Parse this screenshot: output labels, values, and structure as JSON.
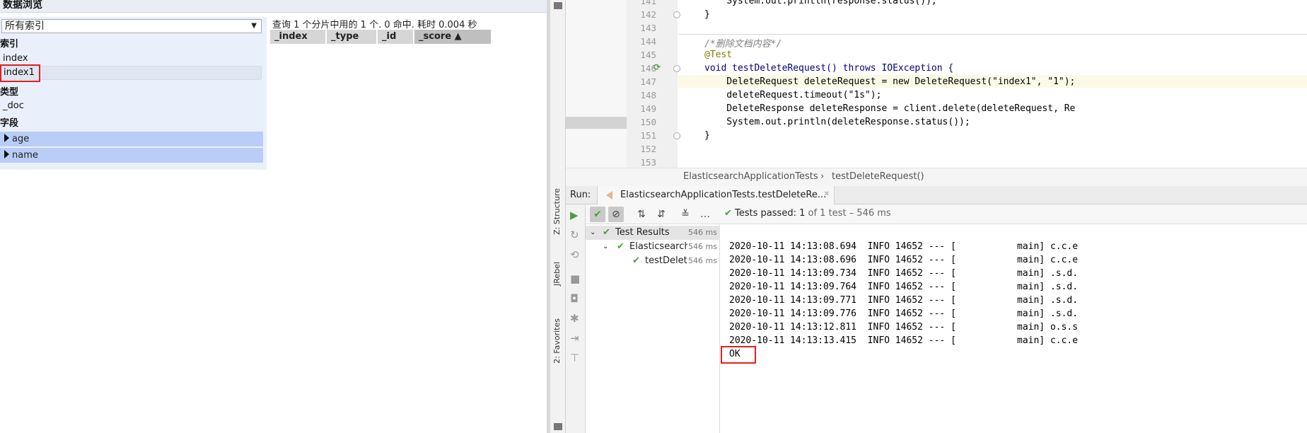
{
  "es": {
    "title": "数据浏览",
    "index_select": "所有索引",
    "sections": {
      "indices": "索引",
      "types": "类型",
      "fields": "字段"
    },
    "indices": [
      "index",
      "index1"
    ],
    "types": [
      "_doc"
    ],
    "fields": [
      "age",
      "name"
    ],
    "query_info": "查询 1 个分片中用的 1 个. 0 命中. 耗时 0.004 秒",
    "columns": [
      "_index",
      "_type",
      "_id",
      "_score ▲"
    ]
  },
  "editor": {
    "lines": [
      {
        "n": "141",
        "text": "    System.out.println(response.status());"
      },
      {
        "n": "142",
        "text": "}"
      },
      {
        "n": "143",
        "text": ""
      },
      {
        "n": "144",
        "text": "/*删除文档内容*/"
      },
      {
        "n": "145",
        "text": "@Test"
      },
      {
        "n": "146",
        "text": "void testDeleteRequest() throws IOException {"
      },
      {
        "n": "147",
        "text": "    DeleteRequest deleteRequest = new DeleteRequest(\"index1\", \"1\");"
      },
      {
        "n": "148",
        "text": "    deleteRequest.timeout(\"1s\");"
      },
      {
        "n": "149",
        "text": "    DeleteResponse deleteResponse = client.delete(deleteRequest, Re"
      },
      {
        "n": "150",
        "text": "    System.out.println(deleteResponse.status());"
      },
      {
        "n": "151",
        "text": "}"
      },
      {
        "n": "152",
        "text": ""
      },
      {
        "n": "153",
        "text": ""
      }
    ],
    "breadcrumb": [
      "ElasticsearchApplicationTests",
      "testDeleteRequest()"
    ]
  },
  "run": {
    "label": "Run:",
    "tab": "ElasticsearchApplicationTests.testDeleteRe...",
    "tests_passed_label": "Tests passed:",
    "tests_passed_value": "1",
    "tests_passed_rest": "of 1 test – 546 ms",
    "sidebar_labels": [
      "Z: Structure",
      "JRebel",
      "2: Favorites"
    ],
    "tree": [
      {
        "name": "Test Results",
        "time": "546 ms"
      },
      {
        "name": "Elasticsearch",
        "time": "546 ms"
      },
      {
        "name": "testDelete",
        "time": "546 ms"
      }
    ],
    "log": [
      "2020-10-11 14:13:08.694  INFO 14652 --- [           main] c.c.e",
      "2020-10-11 14:13:08.696  INFO 14652 --- [           main] c.c.e",
      "2020-10-11 14:13:09.734  INFO 14652 --- [           main] .s.d.",
      "2020-10-11 14:13:09.764  INFO 14652 --- [           main] .s.d.",
      "2020-10-11 14:13:09.771  INFO 14652 --- [           main] .s.d.",
      "2020-10-11 14:13:09.776  INFO 14652 --- [           main] .s.d.",
      "2020-10-11 14:13:12.811  INFO 14652 --- [           main] o.s.s",
      "2020-10-11 14:13:13.415  INFO 14652 --- [           main] c.c.e",
      "OK"
    ]
  },
  "colors": {
    "highlight_red": "#e02020",
    "field_row": "#b9cdf7",
    "pass_green": "#49a041"
  }
}
